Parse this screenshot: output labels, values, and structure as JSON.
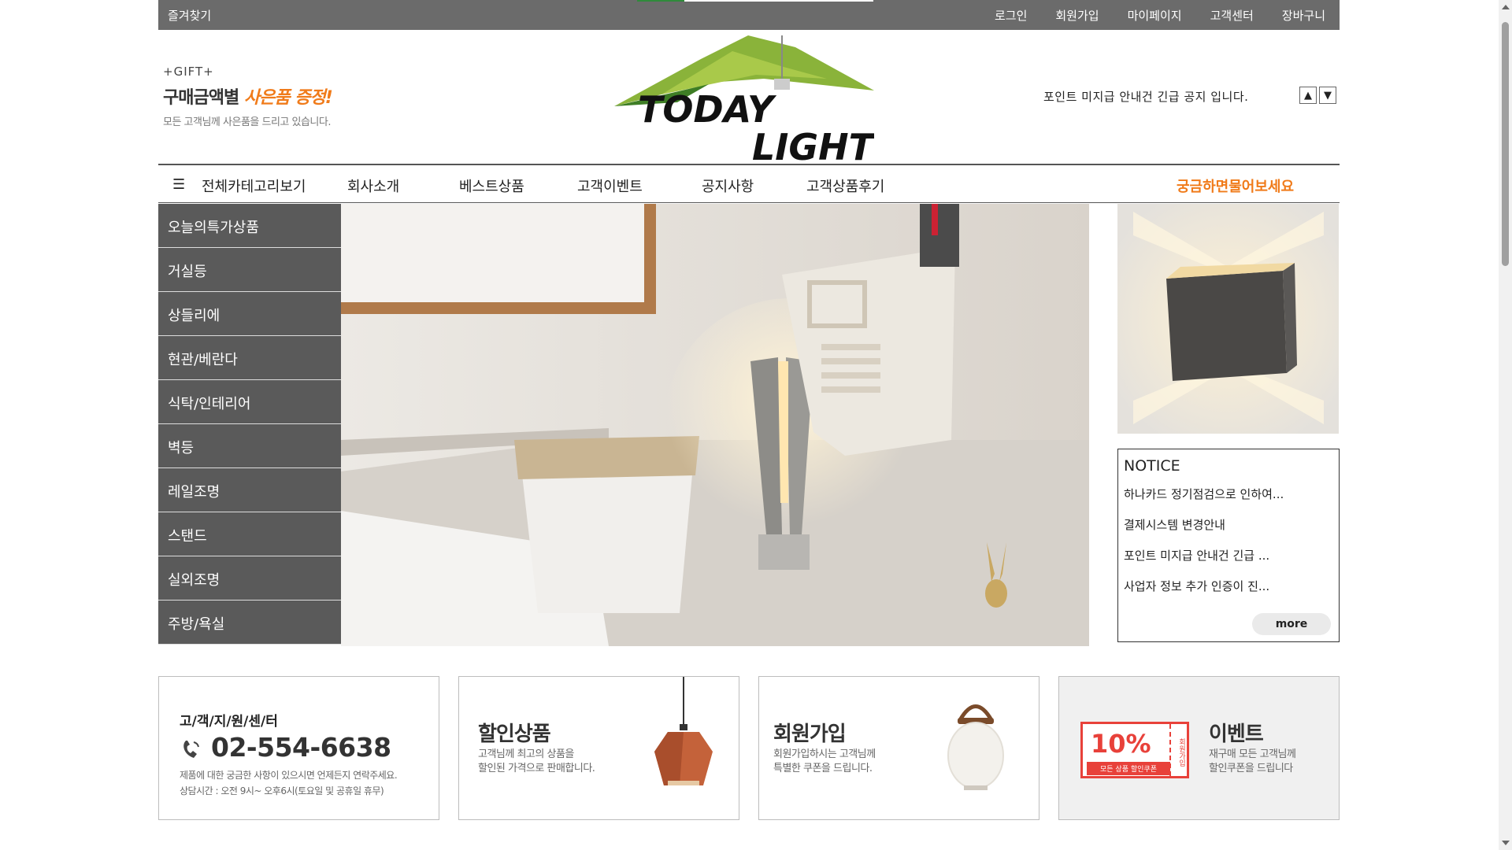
{
  "topbar": {
    "favorites": "즐겨찾기",
    "links": [
      "로그인",
      "회원가입",
      "마이페이지",
      "고객센터",
      "장바구니"
    ]
  },
  "gift": {
    "tag": "+GIFT+",
    "title_main": "구매금액별 ",
    "title_accent": "사은품 증정!",
    "desc": "모든 고객님께 사은품을 드리고 있습니다."
  },
  "logo": {
    "line1": "TODAY",
    "line2": "LIGHT"
  },
  "notice_roll": {
    "text": "포인트 미지급 안내건 긴급 공지 입니다.",
    "up": "▲",
    "down": "▼"
  },
  "nav": {
    "all_categories": "전체카테고리보기",
    "items": [
      "회사소개",
      "베스트상품",
      "고객이벤트",
      "공지사항",
      "고객상품후기"
    ],
    "ask": "궁금하면물어보세요"
  },
  "side_menu": [
    "오늘의특가상품",
    "거실등",
    "상들리에",
    "현관/베란다",
    "식탁/인테리어",
    "벽등",
    "레일조명",
    "스탠드",
    "실외조명",
    "주방/욕실"
  ],
  "notice_box": {
    "title": "NOTICE",
    "items": [
      "하나카드 정기점검으로 인하여...",
      "결제시스템 변경안내",
      "포인트 미지급 안내건 긴급 ...",
      "사업자 정보 추가 인증이 진..."
    ],
    "more": "more"
  },
  "banners": {
    "support": {
      "title": "고/객/지/원/센/터",
      "phone": "02-554-6638",
      "desc1": "제품에 대한 궁금한 사항이 있으시면 언제든지 연락주세요.",
      "desc2": "상담시간 : 오전 9시~ 오후6시(토요일 및 공휴일 휴무)"
    },
    "sale": {
      "title": "할인상품",
      "desc1": "고객님께 최고의 상품을",
      "desc2": "할인된 가격으로 판매합니다."
    },
    "join": {
      "title": "회원가입",
      "desc1": "회원가입하시는 고객님께",
      "desc2": "특별한 쿠폰을 드립니다."
    },
    "event": {
      "title": "이벤트",
      "desc1": "재구매 모든 고객님께",
      "desc2": "할인쿠폰을 드립니다",
      "coupon_value": "10%",
      "coupon_label": "모든 상품 할인쿠폰",
      "coupon_side": "회원가입"
    }
  },
  "colors": {
    "accent": "#f07b1a",
    "topbar": "#6b6b6b",
    "menu": "#5a5a5a",
    "coupon": "#e8413a"
  }
}
